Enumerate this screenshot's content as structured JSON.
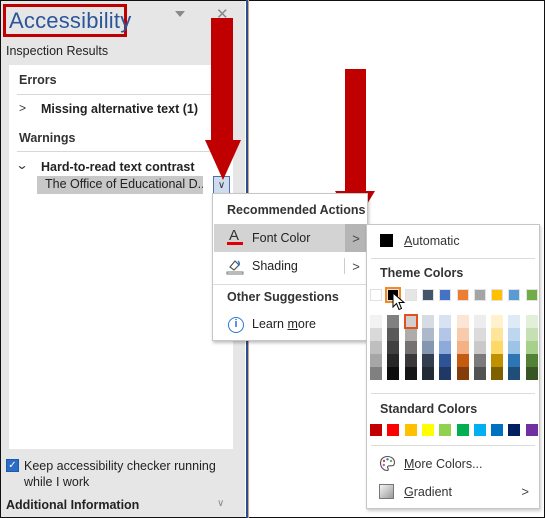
{
  "pane": {
    "title": "Accessibility",
    "subtitle": "Inspection Results",
    "errors_heading": "Errors",
    "error_item": "Missing alternative text (1)",
    "warnings_heading": "Warnings",
    "warning_item": "Hard-to-read text contrast",
    "selected_item": "The Office of Educational D...",
    "keep_running_label": "Keep accessibility checker running while I work",
    "keep_running_checked": true,
    "additional_info": "Additional Information",
    "icons": {
      "menu": "dropdown-triangle-icon",
      "close": "close-icon",
      "collapsed": "chevron-right-icon",
      "expanded": "chevron-down-icon"
    }
  },
  "context_menu": {
    "recommended_heading": "Recommended Actions",
    "items": [
      {
        "label": "Font Color",
        "icon": "font-color-icon",
        "has_submenu": true,
        "highlighted": true
      },
      {
        "label": "Shading",
        "icon": "shading-icon",
        "has_submenu": true,
        "highlighted": false
      }
    ],
    "other_heading": "Other Suggestions",
    "learn_more": "Learn more"
  },
  "color_palette": {
    "automatic_label": "Automatic",
    "automatic_color": "#000000",
    "theme_heading": "Theme Colors",
    "theme_top": [
      "#ffffff",
      "#000000",
      "#e7e6e6",
      "#44546a",
      "#4472c4",
      "#ed7d31",
      "#a5a5a5",
      "#ffc000",
      "#5b9bd5",
      "#70ad47"
    ],
    "theme_shades": [
      [
        "#f2f2f2",
        "#d9d9d9",
        "#bfbfbf",
        "#a6a6a6",
        "#808080"
      ],
      [
        "#808080",
        "#595959",
        "#404040",
        "#262626",
        "#0d0d0d"
      ],
      [
        "#d0cece",
        "#aeabab",
        "#757171",
        "#3a3838",
        "#171616"
      ],
      [
        "#d6dce4",
        "#adb9ca",
        "#8496b0",
        "#333f4f",
        "#222a35"
      ],
      [
        "#d9e2f3",
        "#b4c6e7",
        "#8eaadb",
        "#2f5496",
        "#1f3864"
      ],
      [
        "#fbe5d5",
        "#f7cbac",
        "#f4b183",
        "#c55a11",
        "#843c0b"
      ],
      [
        "#ededed",
        "#dbdbdb",
        "#c9c9c9",
        "#7b7b7b",
        "#525252"
      ],
      [
        "#fff2cc",
        "#fee599",
        "#ffd965",
        "#bf9000",
        "#7f6000"
      ],
      [
        "#deebf6",
        "#bdd7ee",
        "#9dc3e6",
        "#2e75b5",
        "#1f4e79"
      ],
      [
        "#e2efd9",
        "#c5e0b3",
        "#a8d08d",
        "#538135",
        "#375623"
      ]
    ],
    "selected_top_index": 1,
    "selected_shade": {
      "column": 2,
      "row": 0
    },
    "standard_heading": "Standard Colors",
    "standard": [
      "#c00000",
      "#ff0000",
      "#ffc000",
      "#ffff00",
      "#92d050",
      "#00b050",
      "#00b0f0",
      "#0070c0",
      "#002060",
      "#7030a0"
    ],
    "more_colors": "More Colors...",
    "gradient": "Gradient"
  },
  "annotation_color": "#c00000"
}
